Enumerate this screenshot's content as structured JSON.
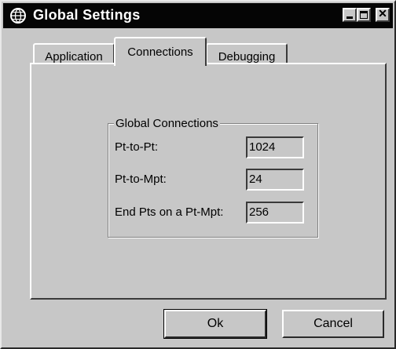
{
  "window": {
    "title": "Global Settings"
  },
  "titlebar": {
    "icon": "globe-icon",
    "buttons": [
      "minimize-icon",
      "maximize-icon",
      "close-icon"
    ]
  },
  "tabs": [
    {
      "label": "Application",
      "selected": false
    },
    {
      "label": "Connections",
      "selected": true
    },
    {
      "label": "Debugging",
      "selected": false
    }
  ],
  "group": {
    "legend": "Global Connections",
    "rows": [
      {
        "label": "Pt-to-Pt:",
        "value": "1024"
      },
      {
        "label": "Pt-to-Mpt:",
        "value": "24"
      },
      {
        "label": "End Pts on a Pt-Mpt:",
        "value": "256"
      }
    ]
  },
  "buttons": {
    "ok": "Ok",
    "cancel": "Cancel"
  }
}
